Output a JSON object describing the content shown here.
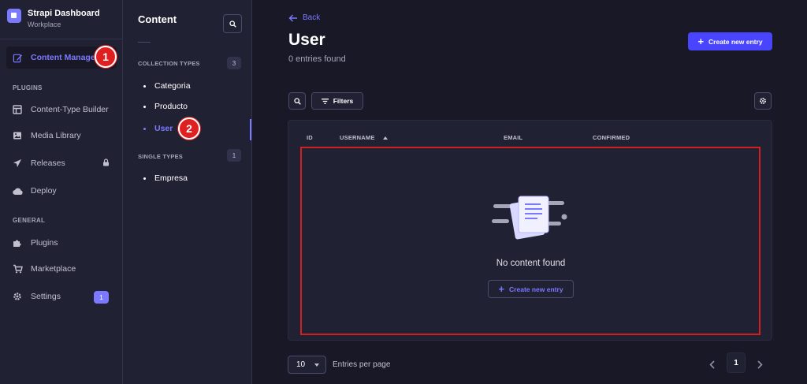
{
  "brand": {
    "title": "Strapi Dashboard",
    "subtitle": "Workplace"
  },
  "nav": {
    "content_manager": "Content Manager",
    "plugins_section": "PLUGINS",
    "content_type_builder": "Content-Type Builder",
    "media_library": "Media Library",
    "releases": "Releases",
    "deploy": "Deploy",
    "general_section": "GENERAL",
    "plugins": "Plugins",
    "marketplace": "Marketplace",
    "settings": "Settings",
    "settings_badge": "1"
  },
  "markers": {
    "one": "1",
    "two": "2"
  },
  "subnav": {
    "title": "Content",
    "collection_types_label": "COLLECTION TYPES",
    "collection_types_count": "3",
    "collection_types": [
      "Categoria",
      "Producto",
      "User"
    ],
    "single_types_label": "SINGLE TYPES",
    "single_types_count": "1",
    "single_types": [
      "Empresa"
    ]
  },
  "main": {
    "back": "Back",
    "title": "User",
    "subtitle": "0 entries found",
    "create_button": "Create new entry",
    "filters_button": "Filters",
    "columns": [
      "ID",
      "USERNAME",
      "EMAIL",
      "CONFIRMED"
    ],
    "empty_text": "No content found",
    "empty_create_button": "Create new entry",
    "page_size": "10",
    "entries_per_page": "Entries per page",
    "current_page": "1"
  },
  "colors": {
    "accent": "#7b79ff",
    "primary": "#4945ff",
    "background": "#181826",
    "panel": "#212134",
    "highlight": "#d02020"
  }
}
